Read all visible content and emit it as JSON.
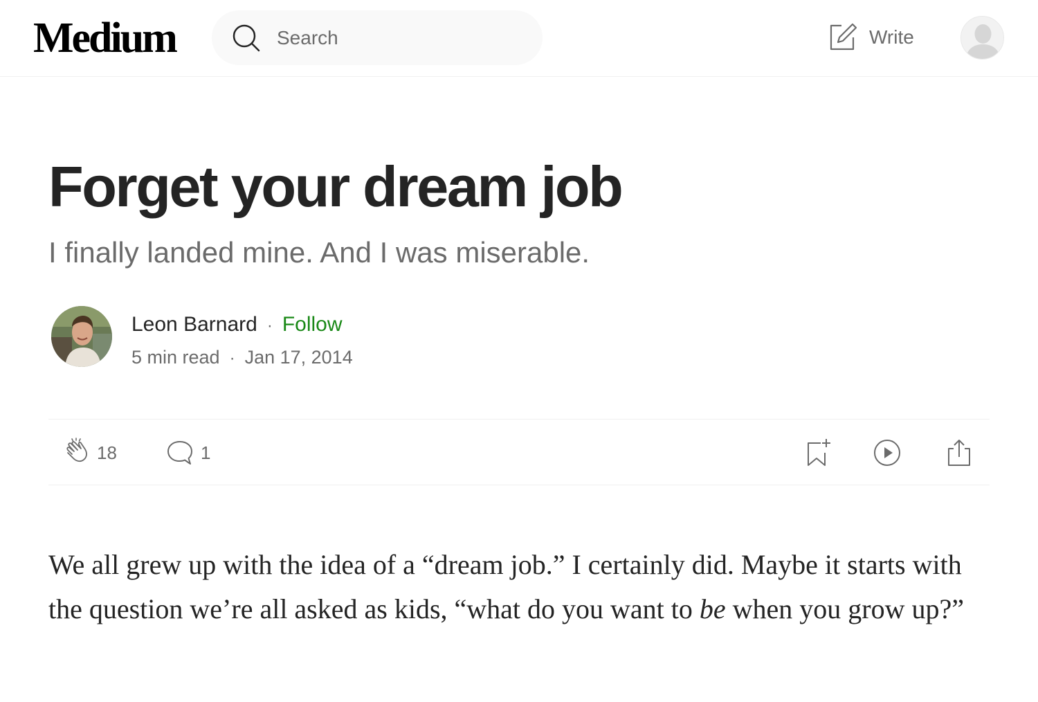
{
  "header": {
    "logo": "Medium",
    "search": {
      "placeholder": "Search",
      "value": ""
    },
    "write_label": "Write"
  },
  "article": {
    "title": "Forget your dream job",
    "subtitle": "I finally landed mine. And I was miserable.",
    "author": {
      "name": "Leon Barnard",
      "separator": "·",
      "follow_label": "Follow",
      "read_time": "5 min read",
      "date": "Jan 17, 2014"
    },
    "actions": {
      "claps": "18",
      "responses": "1"
    },
    "body": {
      "p1_before_em": "We all grew up with the idea of a “dream job.” I certainly did. Maybe it starts with the question we’re all asked as kids, “what do you want to ",
      "p1_em": "be",
      "p1_after_em": " when you grow up?”"
    }
  },
  "icons": {
    "search": "search-icon",
    "write": "write-icon",
    "user": "user-avatar-icon",
    "clap": "clap-icon",
    "response": "comment-icon",
    "save": "bookmark-add-icon",
    "listen": "play-icon",
    "share": "share-icon"
  },
  "colors": {
    "follow": "#1a8917",
    "text": "#242424",
    "muted": "#6b6b6b",
    "search_bg": "#f9f9f9"
  }
}
